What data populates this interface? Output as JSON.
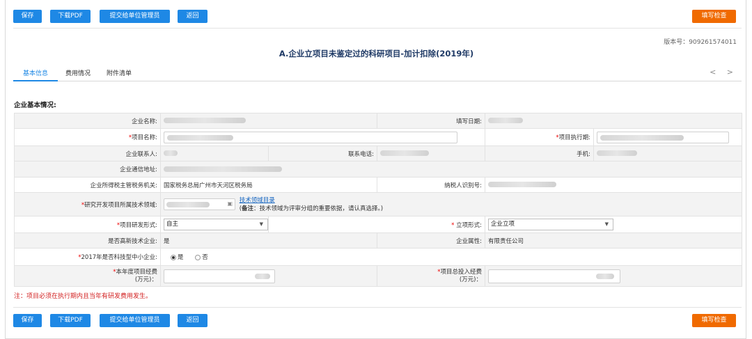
{
  "toolbar": {
    "save": "保存",
    "download_pdf": "下载PDF",
    "submit": "提交给单位管理员",
    "back": "返回",
    "fill_check": "填写检查"
  },
  "version": "版本号：909261574011",
  "title": "A.企业立项目未鉴定过的科研项目-加计扣除(2019年)",
  "tabs": [
    "基本信息",
    "费用情况",
    "附件清单"
  ],
  "tab_nav": "< >",
  "section_title": "企业基本情况:",
  "form": {
    "company_name_label": "企业名称:",
    "fill_date_label": "填写日期:",
    "project_name_label": "项目名称:",
    "project_period_label": "项目执行期:",
    "contact_label": "企业联系人:",
    "phone_label": "联系电话:",
    "mobile_label": "手机:",
    "address_label": "企业通信地址:",
    "tax_authority_label": "企业所得税主管税务机关:",
    "tax_authority_value": "国家税务总局广州市天河区税务局",
    "taxpayer_id_label": "纳税人识别号:",
    "tech_field_label": "研究开发项目所属技术领域:",
    "tech_field_link": "技术领域目录",
    "tech_field_note_bold": "备注",
    "tech_field_note": "：技术领域为评审分组的重要依据，请认真选择。)",
    "tech_field_note_prefix": "(",
    "rd_form_label": "项目研发形式:",
    "rd_form_value": "自主",
    "approval_form_label": " 立项形式:",
    "approval_form_value": "企业立项",
    "high_tech_label": "是否高新技术企业:",
    "high_tech_value": "是",
    "company_type_label": "企业属性:",
    "company_type_value": "有限责任公司",
    "sme_label": "2017年是否科技型中小企业:",
    "sme_yes": "是",
    "sme_no": "否",
    "annual_funds_label_1": "本年度项目经费",
    "annual_funds_label_2": "(万元)：",
    "total_funds_label_1": "项目总投入经费",
    "total_funds_label_2": "(万元)：",
    "required_mark": "*"
  },
  "footnote": "注：项目必须在执行期内且当年有研发费用发生。"
}
